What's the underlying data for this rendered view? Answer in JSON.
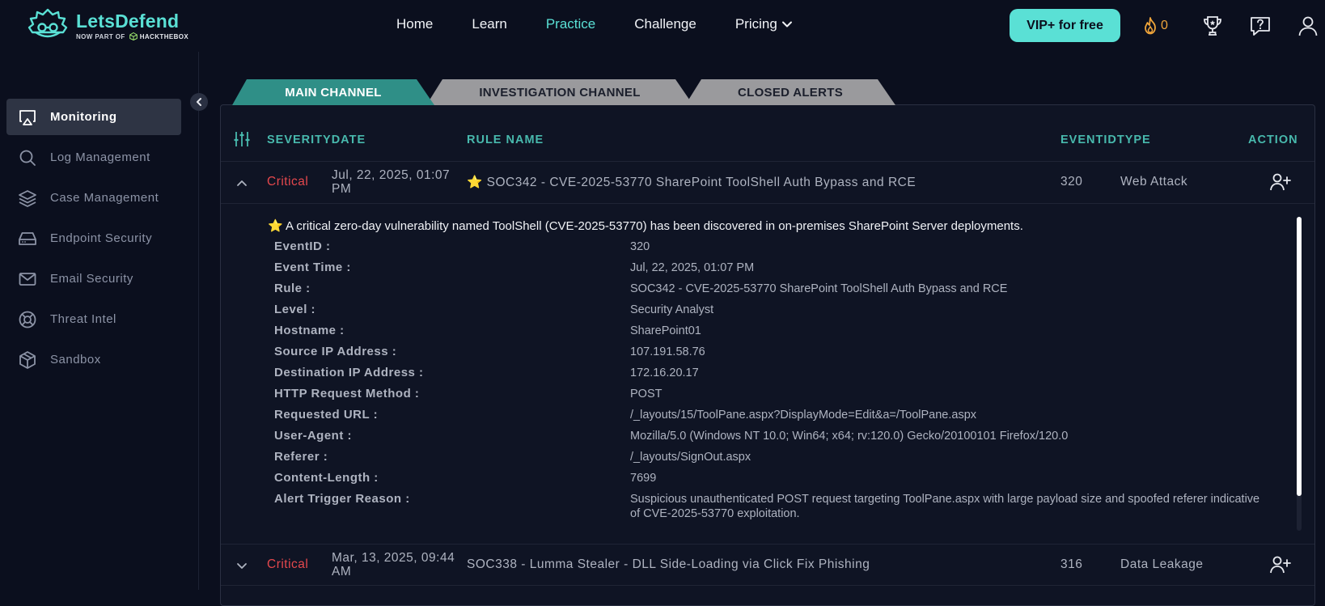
{
  "brand": {
    "title": "LetsDefend",
    "subtitle_prefix": "NOW PART OF",
    "subtitle_brand": "HACKTHEBOX"
  },
  "nav": {
    "items": [
      {
        "label": "Home",
        "active": false
      },
      {
        "label": "Learn",
        "active": false
      },
      {
        "label": "Practice",
        "active": true
      },
      {
        "label": "Challenge",
        "active": false
      },
      {
        "label": "Pricing",
        "active": false
      }
    ]
  },
  "header": {
    "vip_label": "VIP+ for free",
    "streak_count": "0"
  },
  "sidebar": {
    "items": [
      {
        "label": "Monitoring",
        "icon": "monitor-icon",
        "active": true
      },
      {
        "label": "Log Management",
        "icon": "search-icon",
        "active": false
      },
      {
        "label": "Case Management",
        "icon": "layers-icon",
        "active": false
      },
      {
        "label": "Endpoint Security",
        "icon": "drive-icon",
        "active": false
      },
      {
        "label": "Email Security",
        "icon": "mail-icon",
        "active": false
      },
      {
        "label": "Threat Intel",
        "icon": "lifebuoy-icon",
        "active": false
      },
      {
        "label": "Sandbox",
        "icon": "box-icon",
        "active": false
      }
    ]
  },
  "tabs": [
    {
      "label": "MAIN CHANNEL",
      "active": true
    },
    {
      "label": "INVESTIGATION CHANNEL",
      "active": false
    },
    {
      "label": "CLOSED ALERTS",
      "active": false
    }
  ],
  "table": {
    "headers": {
      "severity_date": "SEVERITYDATE",
      "rule_name": "RULE NAME",
      "eventid_type": "EVENTIDTYPE",
      "action": "ACTION"
    },
    "rows": [
      {
        "severity": "Critical",
        "date": "Jul, 22, 2025, 01:07 PM",
        "rule": "⭐ SOC342 - CVE-2025-53770 SharePoint ToolShell Auth Bypass and RCE",
        "event_id": "320",
        "type": "Web Attack",
        "expanded": true
      },
      {
        "severity": "Critical",
        "date": "Mar, 13, 2025, 09:44 AM",
        "rule": "SOC338 - Lumma Stealer - DLL Side-Loading via Click Fix Phishing",
        "event_id": "316",
        "type": "Data Leakage",
        "expanded": false
      }
    ]
  },
  "detail": {
    "description": "⭐ A critical zero-day vulnerability named ToolShell (CVE-2025-53770) has been discovered in on-premises SharePoint Server deployments.",
    "fields": [
      {
        "key": "EventID :",
        "value": "320"
      },
      {
        "key": "Event Time :",
        "value": "Jul, 22, 2025, 01:07 PM"
      },
      {
        "key": "Rule :",
        "value": "SOC342 - CVE-2025-53770 SharePoint ToolShell Auth Bypass and RCE"
      },
      {
        "key": "Level :",
        "value": "Security Analyst"
      },
      {
        "key": "Hostname :",
        "value": "SharePoint01"
      },
      {
        "key": "Source IP Address :",
        "value": "107.191.58.76"
      },
      {
        "key": "Destination IP Address :",
        "value": "172.16.20.17"
      },
      {
        "key": "HTTP Request Method :",
        "value": "POST"
      },
      {
        "key": "Requested URL :",
        "value": "/_layouts/15/ToolPane.aspx?DisplayMode=Edit&a=/ToolPane.aspx"
      },
      {
        "key": "User-Agent :",
        "value": "Mozilla/5.0 (Windows NT 10.0; Win64; x64; rv:120.0) Gecko/20100101 Firefox/120.0"
      },
      {
        "key": "Referer :",
        "value": "/_layouts/SignOut.aspx"
      },
      {
        "key": "Content-Length :",
        "value": "7699"
      },
      {
        "key": "Alert Trigger Reason :",
        "value": "Suspicious unauthenticated POST request targeting ToolPane.aspx with large payload size and spoofed referer indicative of CVE-2025-53770 exploitation."
      }
    ]
  },
  "colors": {
    "accent": "#5ae0d5",
    "background": "#0b0f1e",
    "critical": "#e5484d",
    "tab_active": "#2f8f87",
    "tab_inactive": "#9a9a9d",
    "streak": "#f0a53a"
  }
}
